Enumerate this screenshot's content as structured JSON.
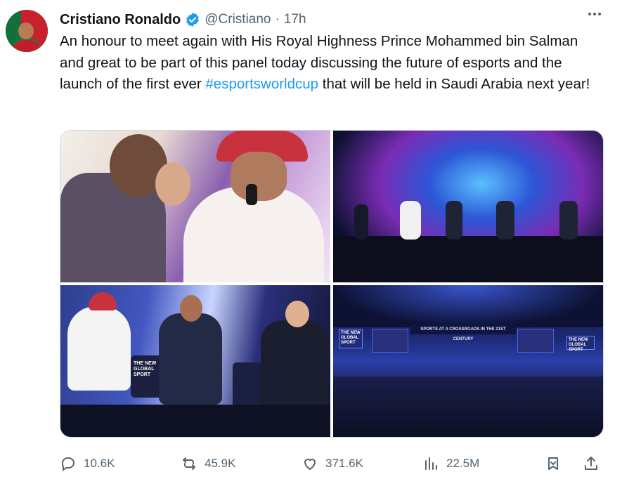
{
  "author": {
    "display_name": "Cristiano Ronaldo",
    "handle": "@Cristiano",
    "separator": "·",
    "time": "17h",
    "verified": true,
    "verified_color": "#1d9bf0"
  },
  "tweet": {
    "text_before": "An honour to meet again with His Royal Highness Prince Mohammed bin Salman and great to be part of this panel today discussing the future of esports and the launch of the first ever ",
    "hashtag": "#esportsworldcup",
    "text_after": " that will be held in Saudi Arabia next year!",
    "hashtag_color": "#1d9bf0"
  },
  "media": {
    "count": 4,
    "stage_text_left": "THE NEW GLOBAL SPORT",
    "stage_banner": "SPORTS AT A CROSSROADS IN THE 21ST CENTURY",
    "stage_text_right": "THE NEW GLOBAL SPORT"
  },
  "actions": {
    "reply_count": "10.6K",
    "repost_count": "45.9K",
    "like_count": "371.6K",
    "views_count": "22.5M",
    "icons": [
      "reply-icon",
      "repost-icon",
      "like-icon",
      "views-icon",
      "bookmark-icon",
      "share-icon"
    ]
  }
}
